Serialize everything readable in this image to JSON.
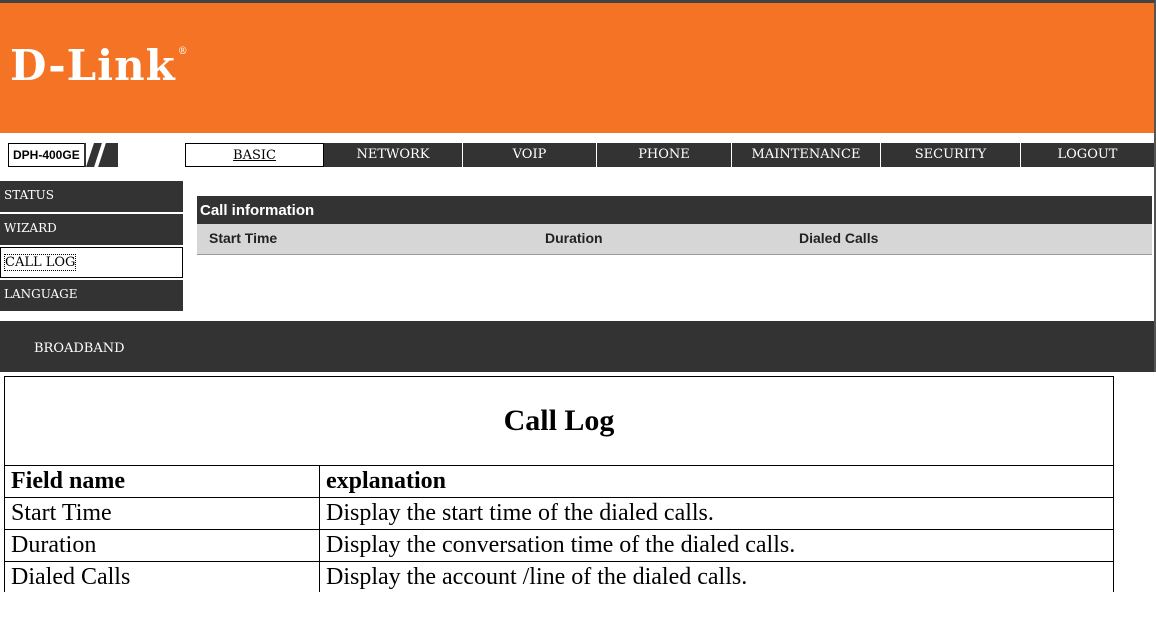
{
  "header": {
    "brand": "D-Link",
    "registered_mark": "®",
    "model": "DPH-400GE",
    "brand_color": "#f47324"
  },
  "topnav": {
    "tabs": [
      {
        "label": "BASIC",
        "active": true
      },
      {
        "label": "NETWORK",
        "active": false
      },
      {
        "label": "VOIP",
        "active": false
      },
      {
        "label": "PHONE",
        "active": false
      },
      {
        "label": "MAINTENANCE",
        "active": false
      },
      {
        "label": "SECURITY",
        "active": false
      },
      {
        "label": "LOGOUT",
        "active": false
      }
    ]
  },
  "leftnav": {
    "items": [
      {
        "label": "STATUS",
        "active": false
      },
      {
        "label": "WIZARD",
        "active": false
      },
      {
        "label": "CALL LOG",
        "active": true
      },
      {
        "label": "LANGUAGE",
        "active": false
      }
    ]
  },
  "call_info": {
    "title": "Call information",
    "columns": [
      "Start Time",
      "Duration",
      "Dialed Calls"
    ]
  },
  "bottombar": {
    "label": "BROADBAND"
  },
  "doc_table": {
    "title": "Call Log",
    "headers": [
      "Field name",
      "explanation"
    ],
    "rows": [
      [
        "Start Time",
        "Display the start time of the dialed calls."
      ],
      [
        "Duration",
        "Display the conversation time of the dialed calls."
      ],
      [
        "Dialed Calls",
        "Display the account /line of the dialed calls."
      ]
    ]
  }
}
